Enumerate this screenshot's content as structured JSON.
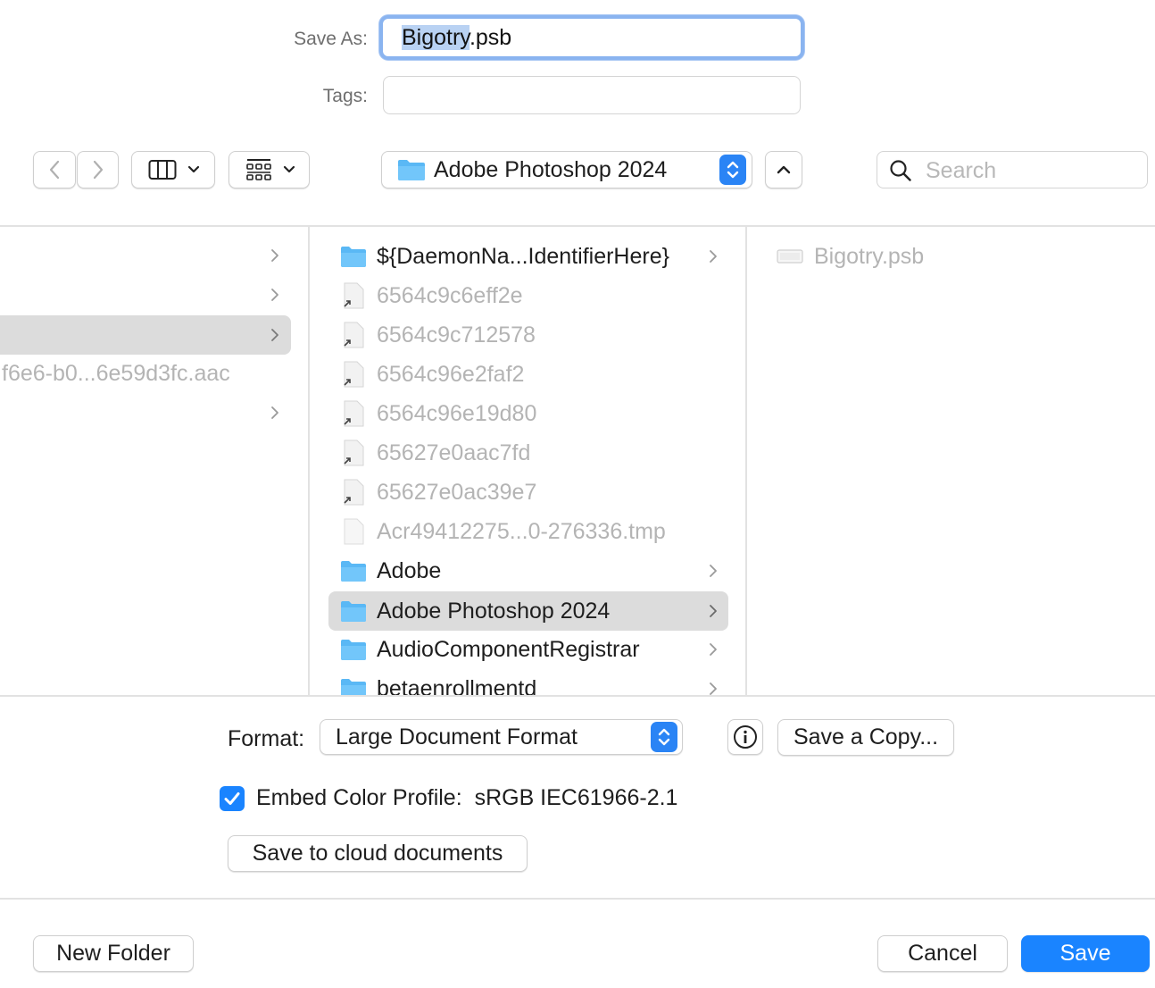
{
  "save_as": {
    "label": "Save As:",
    "value_selected": "Bigotry",
    "value_rest": ".psb"
  },
  "tags": {
    "label": "Tags:",
    "value": ""
  },
  "toolbar": {
    "location": "Adobe Photoshop 2024",
    "search_placeholder": "Search"
  },
  "columns": {
    "col1_rows": [
      {
        "name": "",
        "has_chevron": true,
        "selected": false
      },
      {
        "name": "",
        "has_chevron": true,
        "selected": false
      },
      {
        "name": "",
        "has_chevron": true,
        "selected": true
      },
      {
        "name": "f6e6-b0...6e59d3fc.aac",
        "has_chevron": false,
        "selected": false
      },
      {
        "name": "",
        "has_chevron": true,
        "selected": false
      }
    ],
    "col2_rows": [
      {
        "name": "${DaemonNa...IdentifierHere}",
        "kind": "folder",
        "dim": false,
        "chevron": true
      },
      {
        "name": "6564c9c6eff2e",
        "kind": "alias",
        "dim": true,
        "chevron": false
      },
      {
        "name": "6564c9c712578",
        "kind": "alias",
        "dim": true,
        "chevron": false
      },
      {
        "name": "6564c96e2faf2",
        "kind": "alias",
        "dim": true,
        "chevron": false
      },
      {
        "name": "6564c96e19d80",
        "kind": "alias",
        "dim": true,
        "chevron": false
      },
      {
        "name": "65627e0aac7fd",
        "kind": "alias",
        "dim": true,
        "chevron": false
      },
      {
        "name": "65627e0ac39e7",
        "kind": "alias",
        "dim": true,
        "chevron": false
      },
      {
        "name": "Acr49412275...0-276336.tmp",
        "kind": "file",
        "dim": true,
        "chevron": false
      },
      {
        "name": "Adobe",
        "kind": "folder",
        "dim": false,
        "chevron": true
      },
      {
        "name": "Adobe Photoshop 2024",
        "kind": "folder",
        "dim": false,
        "chevron": true,
        "selected": true
      },
      {
        "name": "AudioComponentRegistrar",
        "kind": "folder",
        "dim": false,
        "chevron": true
      },
      {
        "name": "betaenrollmentd",
        "kind": "folder",
        "dim": false,
        "chevron": true
      }
    ],
    "col3_rows": [
      {
        "name": "Bigotry.psb",
        "kind": "file",
        "dim": true
      }
    ]
  },
  "options": {
    "format_label": "Format:",
    "format_value": "Large Document Format",
    "save_copy_label": "Save a Copy...",
    "embed_label": "Embed Color Profile:",
    "embed_value": "sRGB IEC61966-2.1",
    "embed_checked": true,
    "cloud_label": "Save to cloud documents"
  },
  "footer": {
    "new_folder_label": "New Folder",
    "cancel_label": "Cancel",
    "save_label": "Save"
  },
  "colors": {
    "accent": "#1a84ff",
    "selection": "#b9d2f3",
    "folder": "#5ab8f5"
  }
}
